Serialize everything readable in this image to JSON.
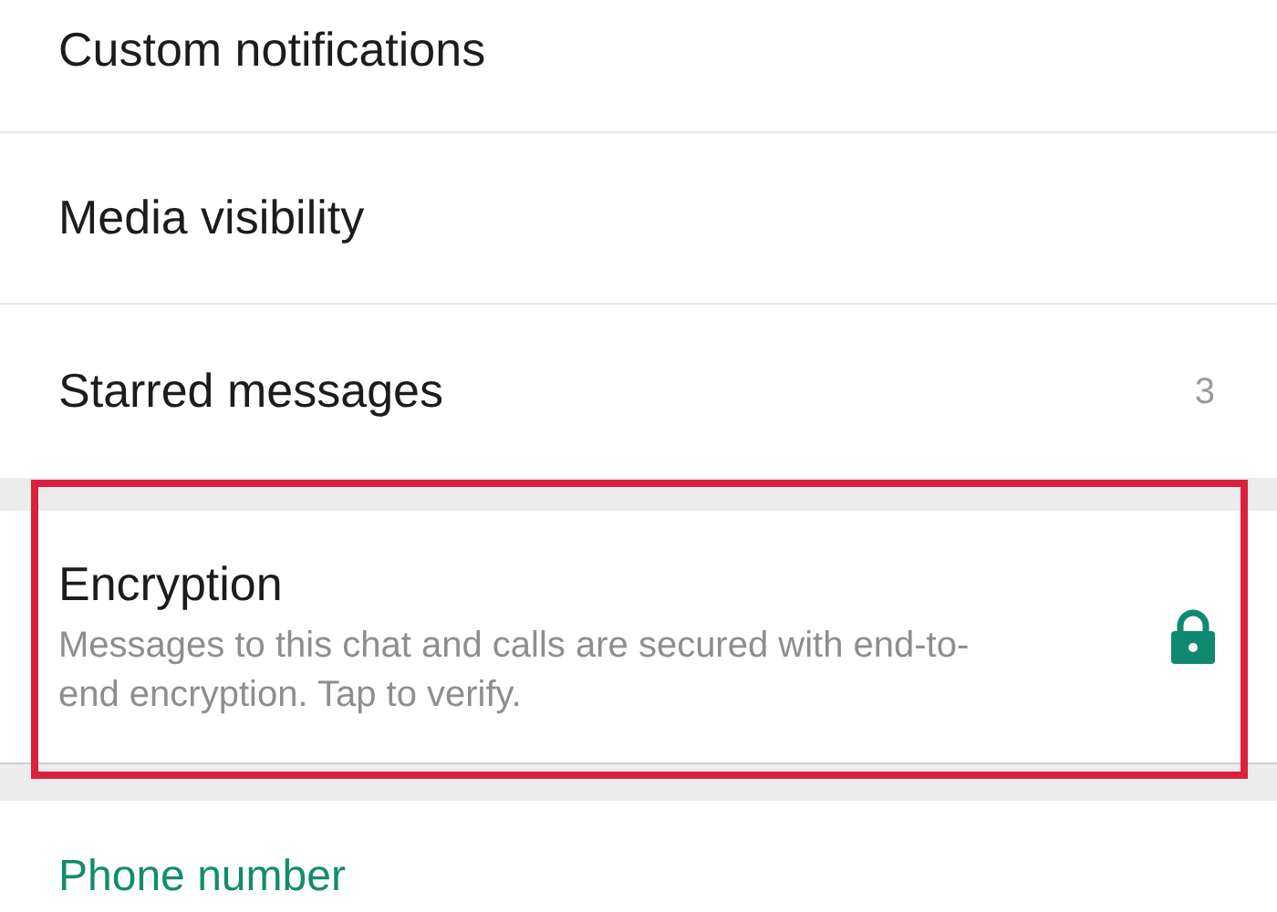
{
  "settings": [
    {
      "label": "Custom notifications"
    },
    {
      "label": "Media visibility"
    },
    {
      "label": "Starred messages",
      "count": "3"
    }
  ],
  "encryption": {
    "title": "Encryption",
    "description": "Messages to this chat and calls are secured with end-to-end encryption. Tap to verify.",
    "highlighted": true
  },
  "section_header": "Phone number"
}
